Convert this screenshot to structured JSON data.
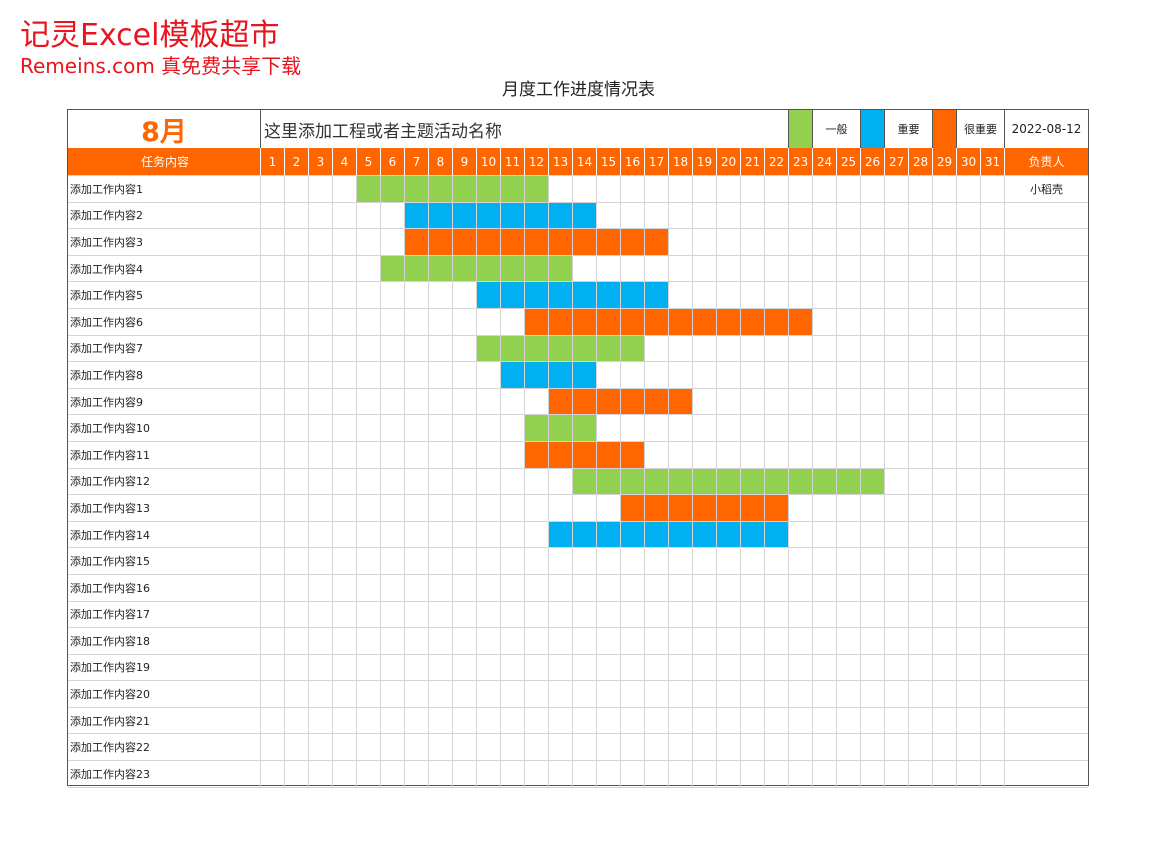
{
  "watermark": {
    "line1": "记灵Excel模板超市",
    "line2": "Remeins.com 真免费共享下载"
  },
  "title": "月度工作进度情况表",
  "header": {
    "month": "8月",
    "project_name": "这里添加工程或者主题活动名称",
    "date": "2022-08-12",
    "legend": [
      {
        "label": "一般",
        "color": "#92d050"
      },
      {
        "label": "重要",
        "color": "#00b0f0"
      },
      {
        "label": "很重要",
        "color": "#ff6600"
      }
    ]
  },
  "columns": {
    "task": "任务内容",
    "owner": "负责人",
    "days": [
      "1",
      "2",
      "3",
      "4",
      "5",
      "6",
      "7",
      "8",
      "9",
      "10",
      "11",
      "12",
      "13",
      "14",
      "15",
      "16",
      "17",
      "18",
      "19",
      "20",
      "21",
      "22",
      "23",
      "24",
      "25",
      "26",
      "27",
      "28",
      "29",
      "30",
      "31"
    ]
  },
  "tasks": [
    {
      "name": "添加工作内容1",
      "owner": "小稻壳",
      "start": 5,
      "end": 12,
      "priority": "一般"
    },
    {
      "name": "添加工作内容2",
      "owner": "",
      "start": 7,
      "end": 14,
      "priority": "重要"
    },
    {
      "name": "添加工作内容3",
      "owner": "",
      "start": 7,
      "end": 17,
      "priority": "很重要"
    },
    {
      "name": "添加工作内容4",
      "owner": "",
      "start": 6,
      "end": 13,
      "priority": "一般"
    },
    {
      "name": "添加工作内容5",
      "owner": "",
      "start": 10,
      "end": 17,
      "priority": "重要"
    },
    {
      "name": "添加工作内容6",
      "owner": "",
      "start": 12,
      "end": 23,
      "priority": "很重要"
    },
    {
      "name": "添加工作内容7",
      "owner": "",
      "start": 10,
      "end": 16,
      "priority": "一般"
    },
    {
      "name": "添加工作内容8",
      "owner": "",
      "start": 11,
      "end": 14,
      "priority": "重要"
    },
    {
      "name": "添加工作内容9",
      "owner": "",
      "start": 13,
      "end": 18,
      "priority": "很重要"
    },
    {
      "name": "添加工作内容10",
      "owner": "",
      "start": 12,
      "end": 14,
      "priority": "一般"
    },
    {
      "name": "添加工作内容11",
      "owner": "",
      "start": 12,
      "end": 16,
      "priority": "很重要"
    },
    {
      "name": "添加工作内容12",
      "owner": "",
      "start": 14,
      "end": 26,
      "priority": "一般"
    },
    {
      "name": "添加工作内容13",
      "owner": "",
      "start": 16,
      "end": 22,
      "priority": "很重要"
    },
    {
      "name": "添加工作内容14",
      "owner": "",
      "start": 13,
      "end": 22,
      "priority": "重要"
    },
    {
      "name": "添加工作内容15",
      "owner": ""
    },
    {
      "name": "添加工作内容16",
      "owner": ""
    },
    {
      "name": "添加工作内容17",
      "owner": ""
    },
    {
      "name": "添加工作内容18",
      "owner": ""
    },
    {
      "name": "添加工作内容19",
      "owner": ""
    },
    {
      "name": "添加工作内容20",
      "owner": ""
    },
    {
      "name": "添加工作内容21",
      "owner": ""
    },
    {
      "name": "添加工作内容22",
      "owner": ""
    },
    {
      "name": "添加工作内容23",
      "owner": ""
    }
  ]
}
